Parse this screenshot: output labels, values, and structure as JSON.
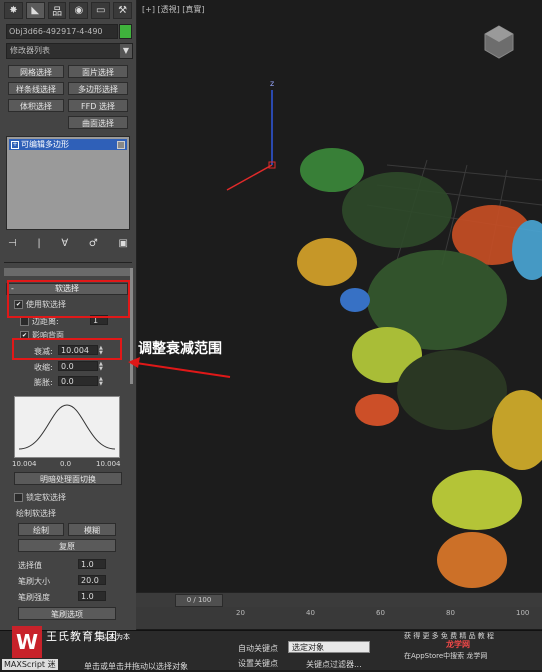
{
  "window": {
    "viewport_label": "[+] [透視] [真實]"
  },
  "tabs": [
    {
      "icon": "create-icon",
      "glyph": "✸"
    },
    {
      "icon": "modify-icon",
      "glyph": "◣"
    },
    {
      "icon": "hierarchy-icon",
      "glyph": "品"
    },
    {
      "icon": "motion-icon",
      "glyph": "◉"
    },
    {
      "icon": "display-icon",
      "glyph": "▭"
    },
    {
      "icon": "utilities-icon",
      "glyph": "⚒"
    }
  ],
  "object": {
    "name": "Obj3d66-492917-4-490",
    "color": "#3fb33c"
  },
  "modifier_list": {
    "label": "修改器列表",
    "arrow": "▼"
  },
  "quick_buttons": [
    "网格选择",
    "面片选择",
    "样条线选择",
    "多边形选择",
    "体积选择",
    "FFD 选择",
    "曲面选择"
  ],
  "stack": {
    "items": [
      {
        "label": "可编辑多边形",
        "expander": "+"
      }
    ]
  },
  "stack_toolbar": [
    "⊣",
    "|",
    "∀",
    "♂",
    "▣"
  ],
  "soft_selection": {
    "header": "软选择",
    "header_toggle": "-",
    "use_soft_selection": {
      "label": "使用软选择",
      "checked": true
    },
    "edge_distance": {
      "label": "边距离:",
      "value": "1"
    },
    "affect_backfacing": {
      "label": "影响背面",
      "checked": true
    },
    "falloff": {
      "label": "衰减:",
      "value": "10.004"
    },
    "pinch": {
      "label": "收缩:",
      "value": "0.0"
    },
    "bubble": {
      "label": "膨胀:",
      "value": "0.0"
    },
    "curve_labels": [
      "10.004",
      "0.0",
      "10.004"
    ],
    "shaded_face_toggle": "明暗处理面切换",
    "lock_soft_selection": {
      "label": "锁定软选择",
      "checked": false
    }
  },
  "paint_soft_selection": {
    "header": "绘制软选择",
    "paint": "绘制",
    "blur": "模糊",
    "revert": "复原",
    "selection_value": {
      "label": "选择值",
      "value": "1.0"
    },
    "brush_size": {
      "label": "笔刷大小",
      "value": "20.0"
    },
    "brush_strength": {
      "label": "笔刷强度",
      "value": "1.0"
    },
    "brush_options": "笔刷选项"
  },
  "annotation": {
    "text": "调整衰减范围"
  },
  "timeline": {
    "slider": "0 / 100",
    "ticks": [
      "0",
      "20",
      "40",
      "60",
      "80",
      "100"
    ]
  },
  "status": {
    "maxscript": "MAXScript 迷",
    "prompt": "单击或单击并拖动以选择对象",
    "auto_key": "自动关键点",
    "set_key": "设置关键点",
    "selected_object": "选定对象",
    "key_filters": "关键点过滤器...",
    "brand": "王氏教育集团",
    "brand_sub": "以人为本",
    "watermark1": "获 得 更 多 免 费 精 品 教 程",
    "watermark2": "在AppStore中搜索 龙学网",
    "watermark_logo": "龙学网"
  }
}
